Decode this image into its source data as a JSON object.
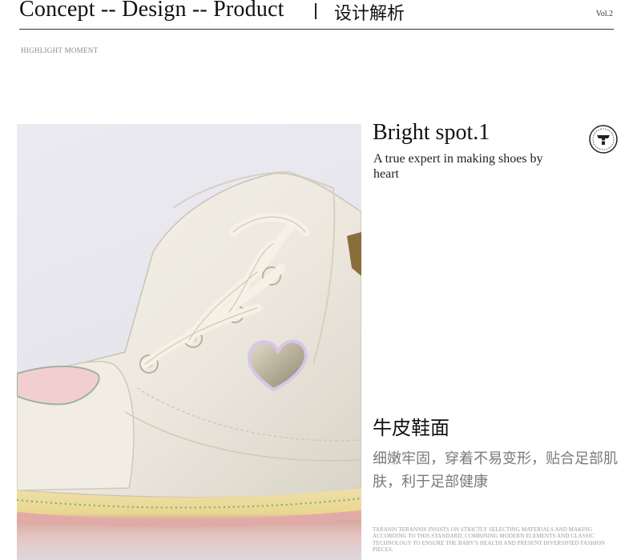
{
  "header": {
    "title": "Concept -- Design -- Product",
    "title_cn": "设计解析",
    "volume": "Vol.2",
    "subheader": "HIGHLIGHT MOMENT"
  },
  "highlight": {
    "title": "Bright spot.1",
    "subtitle": "A true expert in making shoes by heart"
  },
  "feature": {
    "title": "牛皮鞋面",
    "description": "细嫩牢固，穿着不易变形，贴合足部肌肤，利于足部健康"
  },
  "fine_print": "TARANIS TERANNIS INSISTS ON STRICTLY SELECTING MATERIALS AND MAKING ACCORDING TO THIS STANDARD, COMBINING MODERN ELEMENTS AND CLASSIC TECHNOLOGY TO ENSURE THE BABY'S HEALTH AND PRESENT DIVERSIFIED FASHION PIECES.",
  "colors": {
    "accent_text": "#7a7a7a",
    "rule": "#333333",
    "photo_background": "#e9e7ee"
  },
  "icons": {
    "badge": "brand-emblem-icon"
  }
}
